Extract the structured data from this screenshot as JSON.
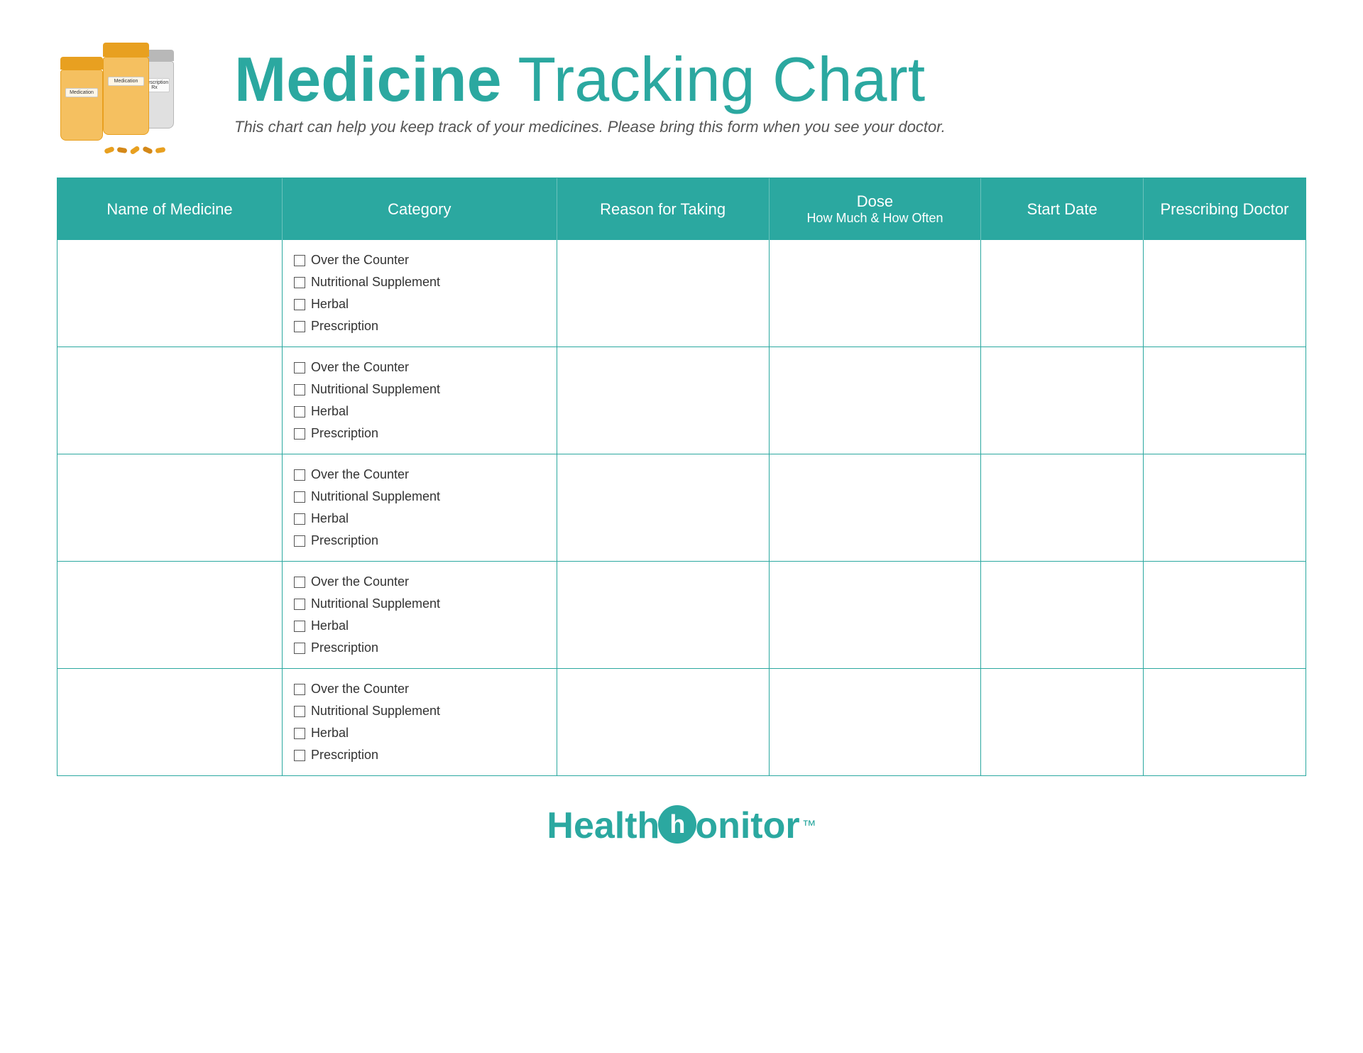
{
  "header": {
    "title_medicine": "Medicine",
    "title_tracking": "Tracking",
    "title_chart": "Chart",
    "subtitle": "This chart can help you keep track of your medicines. Please bring this form when you see your doctor."
  },
  "table": {
    "columns": [
      {
        "id": "name",
        "label": "Name of Medicine",
        "sublabel": null
      },
      {
        "id": "category",
        "label": "Category",
        "sublabel": null
      },
      {
        "id": "reason",
        "label": "Reason for Taking",
        "sublabel": null
      },
      {
        "id": "dose",
        "label": "Dose",
        "sublabel": "How Much & How Often"
      },
      {
        "id": "start",
        "label": "Start Date",
        "sublabel": null
      },
      {
        "id": "doctor",
        "label": "Prescribing Doctor",
        "sublabel": null
      }
    ],
    "category_options": [
      "Over the Counter",
      "Nutritional Supplement",
      "Herbal",
      "Prescription"
    ],
    "rows": [
      {
        "id": 1
      },
      {
        "id": 2
      },
      {
        "id": 3
      },
      {
        "id": 4
      },
      {
        "id": 5
      }
    ]
  },
  "footer": {
    "logo_health": "Health",
    "logo_h": "h",
    "logo_monitor": "onitor",
    "trademark": "™"
  },
  "bottles": {
    "label1": "Medication",
    "label2": "Prescription Rx"
  }
}
